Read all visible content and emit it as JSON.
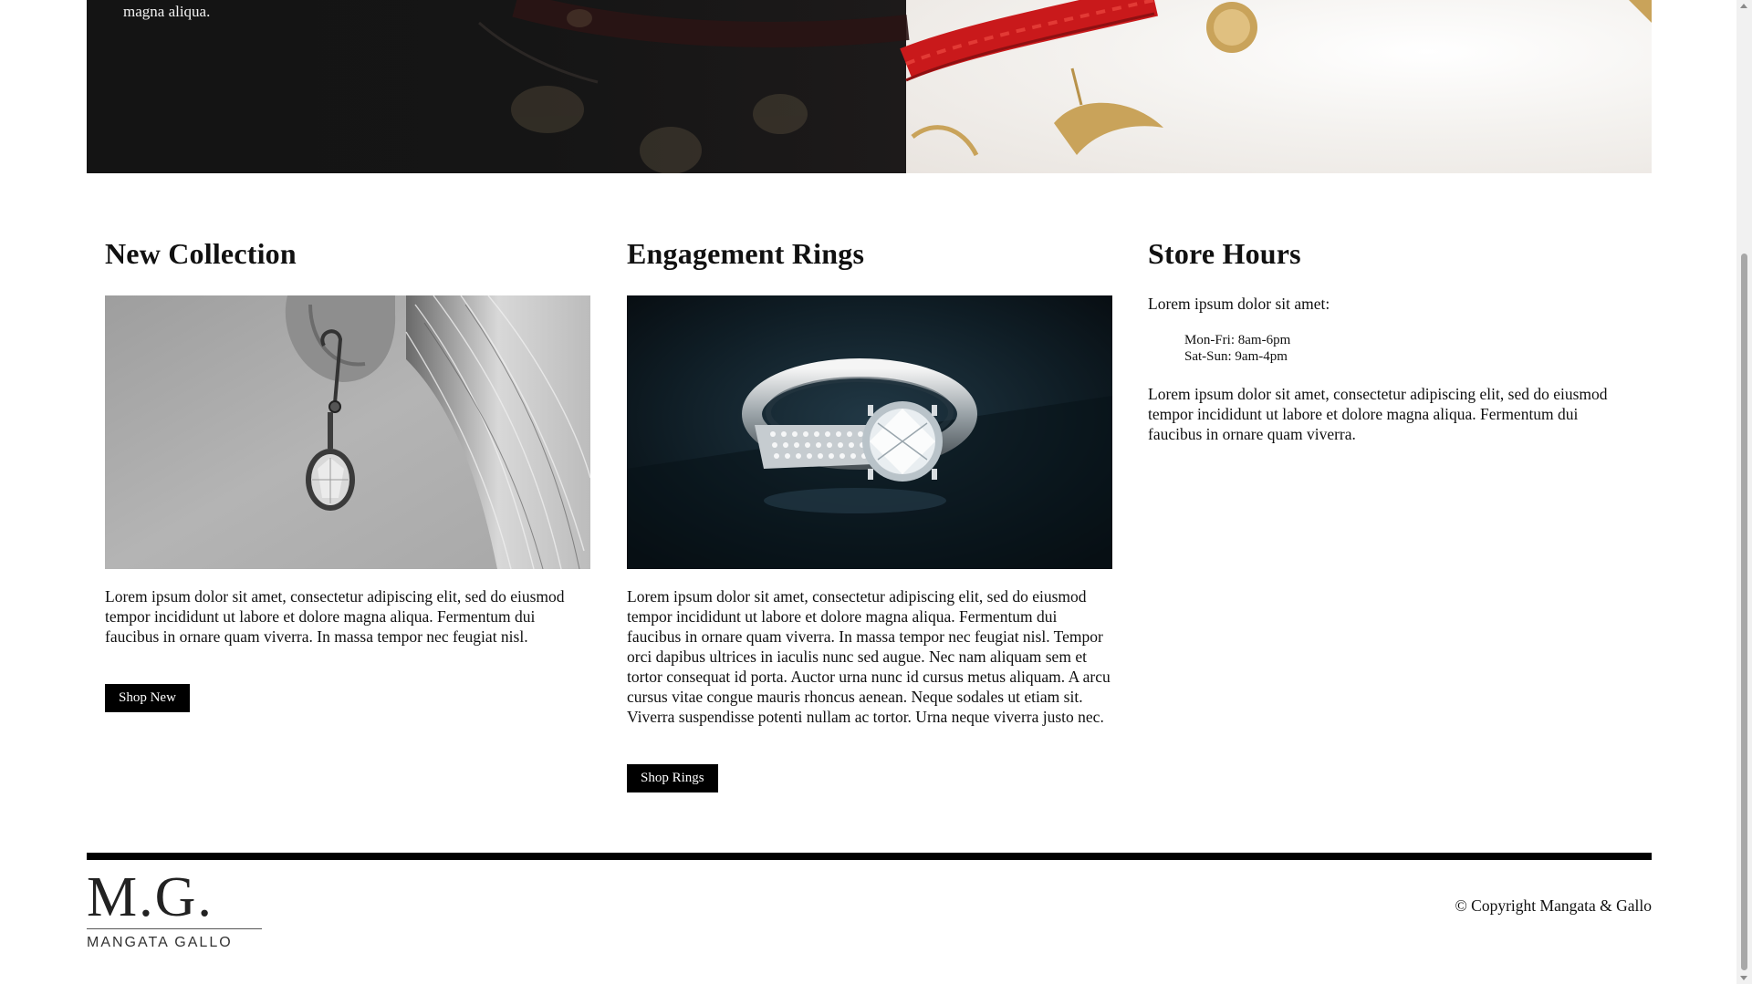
{
  "hero": {
    "text": "magna aliqua."
  },
  "columns": [
    {
      "title": "New Collection",
      "image": "earring-photo",
      "body": "Lorem ipsum dolor sit amet, consectetur adipiscing elit, sed do eiusmod tempor incididunt ut labore et dolore magna aliqua. Fermentum dui faucibus in ornare quam viverra. In massa tempor nec feugiat nisl.",
      "button": "Shop New"
    },
    {
      "title": "Engagement Rings",
      "image": "ring-photo",
      "body": "Lorem ipsum dolor sit amet, consectetur adipiscing elit, sed do eiusmod tempor incididunt ut labore et dolore magna aliqua. Fermentum dui faucibus in ornare quam viverra. In massa tempor nec feugiat nisl. Tempor orci dapibus ultrices in iaculis nunc sed augue. Nec nam aliquam sem et tortor consequat id porta. Auctor urna nunc id cursus metus aliquam. A arcu cursus vitae congue mauris rhoncus aenean. Neque sodales ut etiam sit. Viverra suspendisse potenti nullam ac tortor. Urna neque viverra justo nec.",
      "button": "Shop Rings"
    }
  ],
  "store_hours": {
    "title": "Store Hours",
    "intro": "Lorem ipsum dolor sit amet:",
    "hours": [
      "Mon-Fri: 8am-6pm",
      "Sat-Sun: 9am-4pm"
    ],
    "body": "Lorem ipsum dolor sit amet, consectetur adipiscing elit, sed do eiusmod tempor incididunt ut labore et dolore magna aliqua. Fermentum dui faucibus in ornare quam viverra."
  },
  "footer": {
    "logo_mark": "M.G.",
    "logo_sub": "MANGATA GALLO",
    "copyright": "© Copyright Mangata & Gallo"
  },
  "colors": {
    "accent": "#000000",
    "bracelet_red": "#c9191b",
    "gold": "#c9a35a"
  }
}
